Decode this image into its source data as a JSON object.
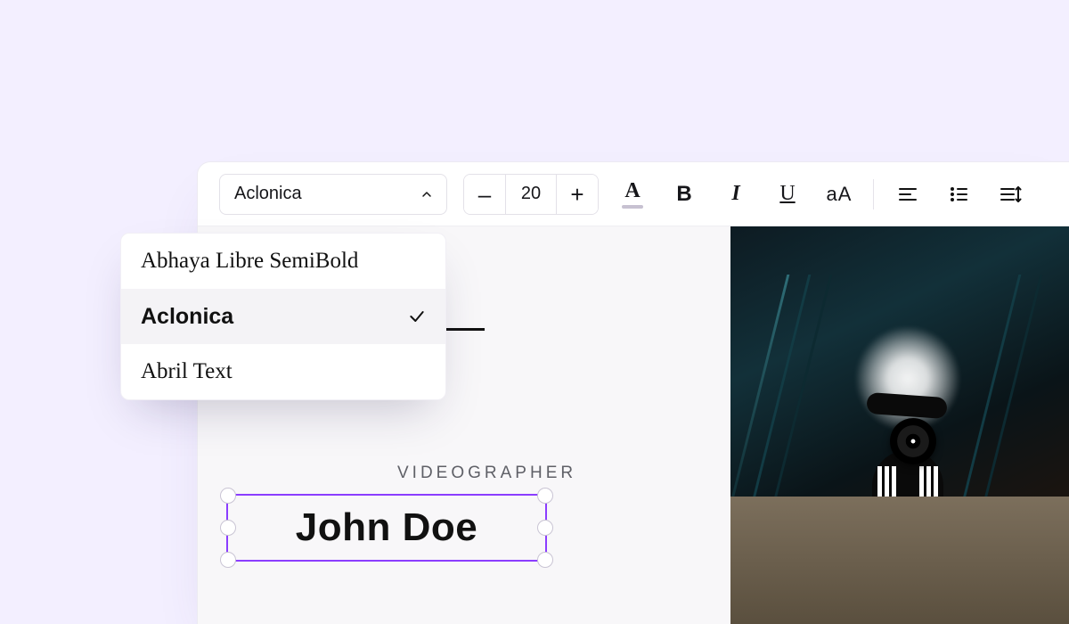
{
  "toolbar": {
    "font": {
      "selected": "Aclonica",
      "options": [
        "Abhaya Libre SemiBold",
        "Aclonica",
        "Abril Text"
      ]
    },
    "font_size": "20",
    "text_color_glyph": "A",
    "bold_glyph": "B",
    "italic_glyph": "I",
    "underline_glyph": "U",
    "case_glyph": "aA"
  },
  "document": {
    "subtitle": "VIDEOGRAPHER",
    "name": "John Doe"
  },
  "colors": {
    "selection": "#8b3dff"
  }
}
